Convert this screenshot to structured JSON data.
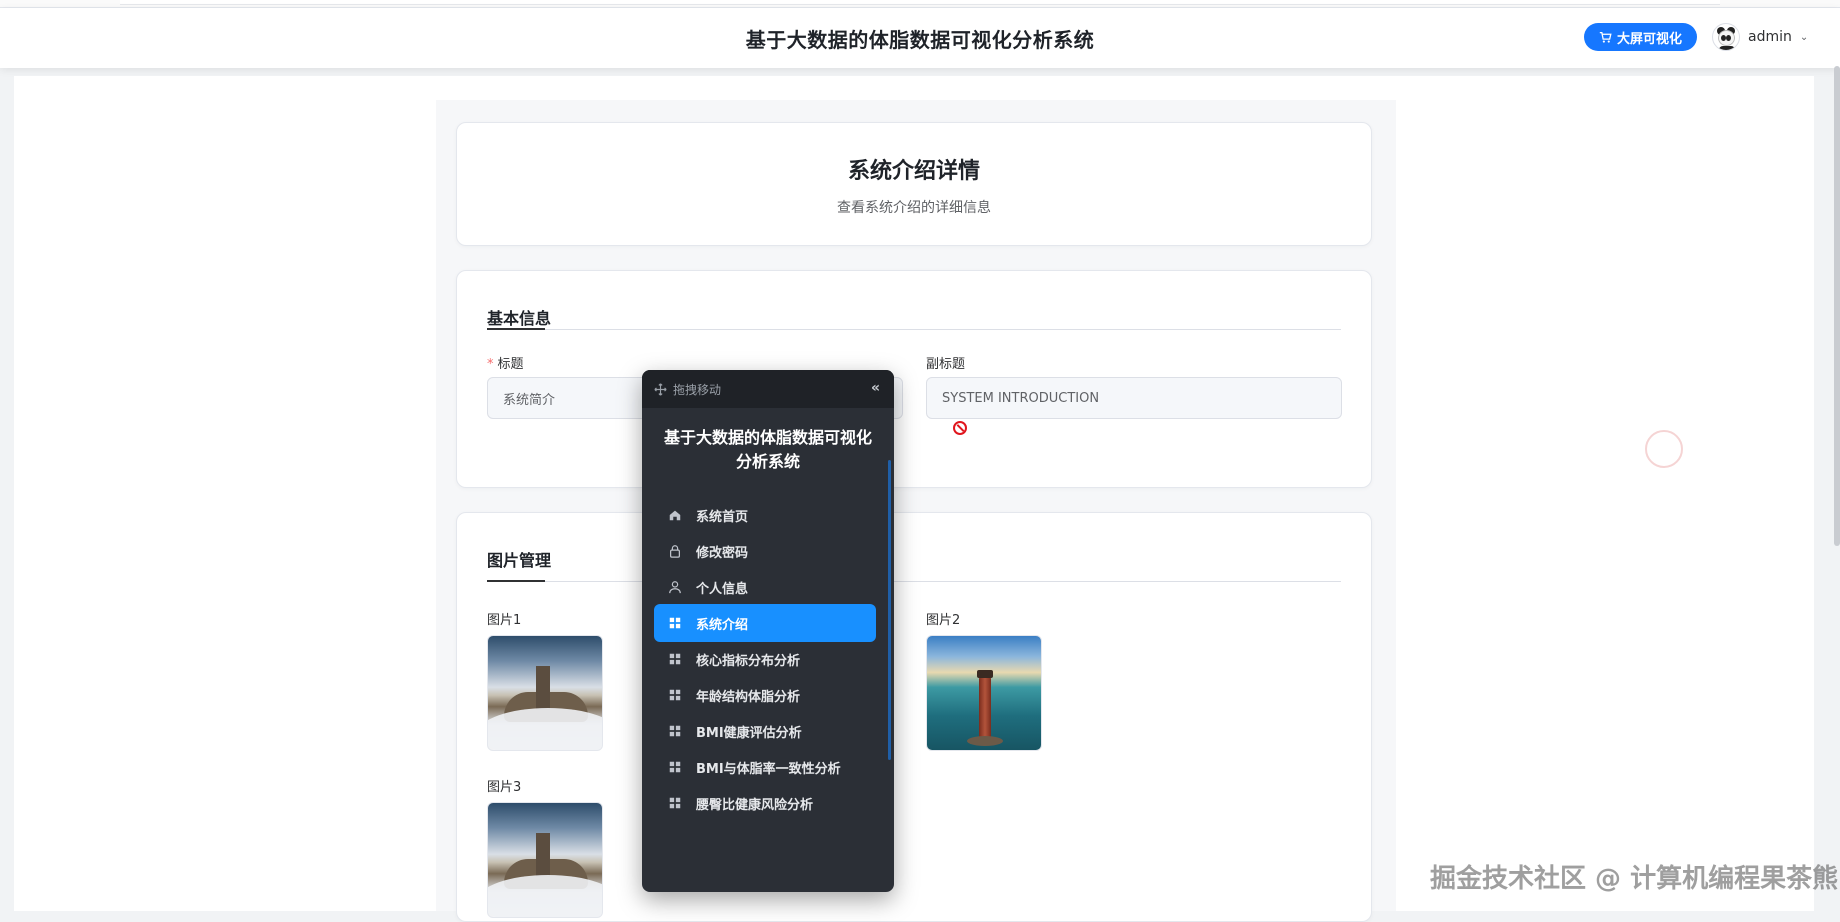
{
  "header": {
    "app_title": "基于大数据的体脂数据可视化分析系统",
    "dashboard_button": "大屏可视化",
    "username": "admin",
    "dropdown_caret": "⌄"
  },
  "page_header": {
    "title": "系统介绍详情",
    "subtitle": "查看系统介绍的详细信息"
  },
  "basic_info": {
    "section_title": "基本信息",
    "title_label": "标题",
    "title_value": "系统简介",
    "subtitle_label": "副标题",
    "subtitle_value": "SYSTEM INTRODUCTION"
  },
  "images": {
    "section_title": "图片管理",
    "items": [
      {
        "label": "图片1"
      },
      {
        "label": "图片2"
      },
      {
        "label": "图片3"
      }
    ]
  },
  "nav_panel": {
    "drag_label": "拖拽移动",
    "collapse_glyph": "«",
    "title": "基于大数据的体脂数据可视化分析系统",
    "items": [
      {
        "label": "系统首页",
        "icon": "home-icon"
      },
      {
        "label": "修改密码",
        "icon": "lock-icon"
      },
      {
        "label": "个人信息",
        "icon": "user-icon"
      },
      {
        "label": "系统介绍",
        "icon": "grid-icon",
        "active": true
      },
      {
        "label": "核心指标分布分析",
        "icon": "grid-icon"
      },
      {
        "label": "年龄结构体脂分析",
        "icon": "grid-icon"
      },
      {
        "label": "BMI健康评估分析",
        "icon": "grid-icon"
      },
      {
        "label": "BMI与体脂率一致性分析",
        "icon": "grid-icon"
      },
      {
        "label": "腰臀比健康风险分析",
        "icon": "grid-icon"
      }
    ]
  },
  "watermark": "掘金技术社区 @ 计算机编程果茶熊",
  "colors": {
    "accent": "#1677ff",
    "nav_bg": "#2b2f36",
    "nav_active": "#1890ff"
  }
}
